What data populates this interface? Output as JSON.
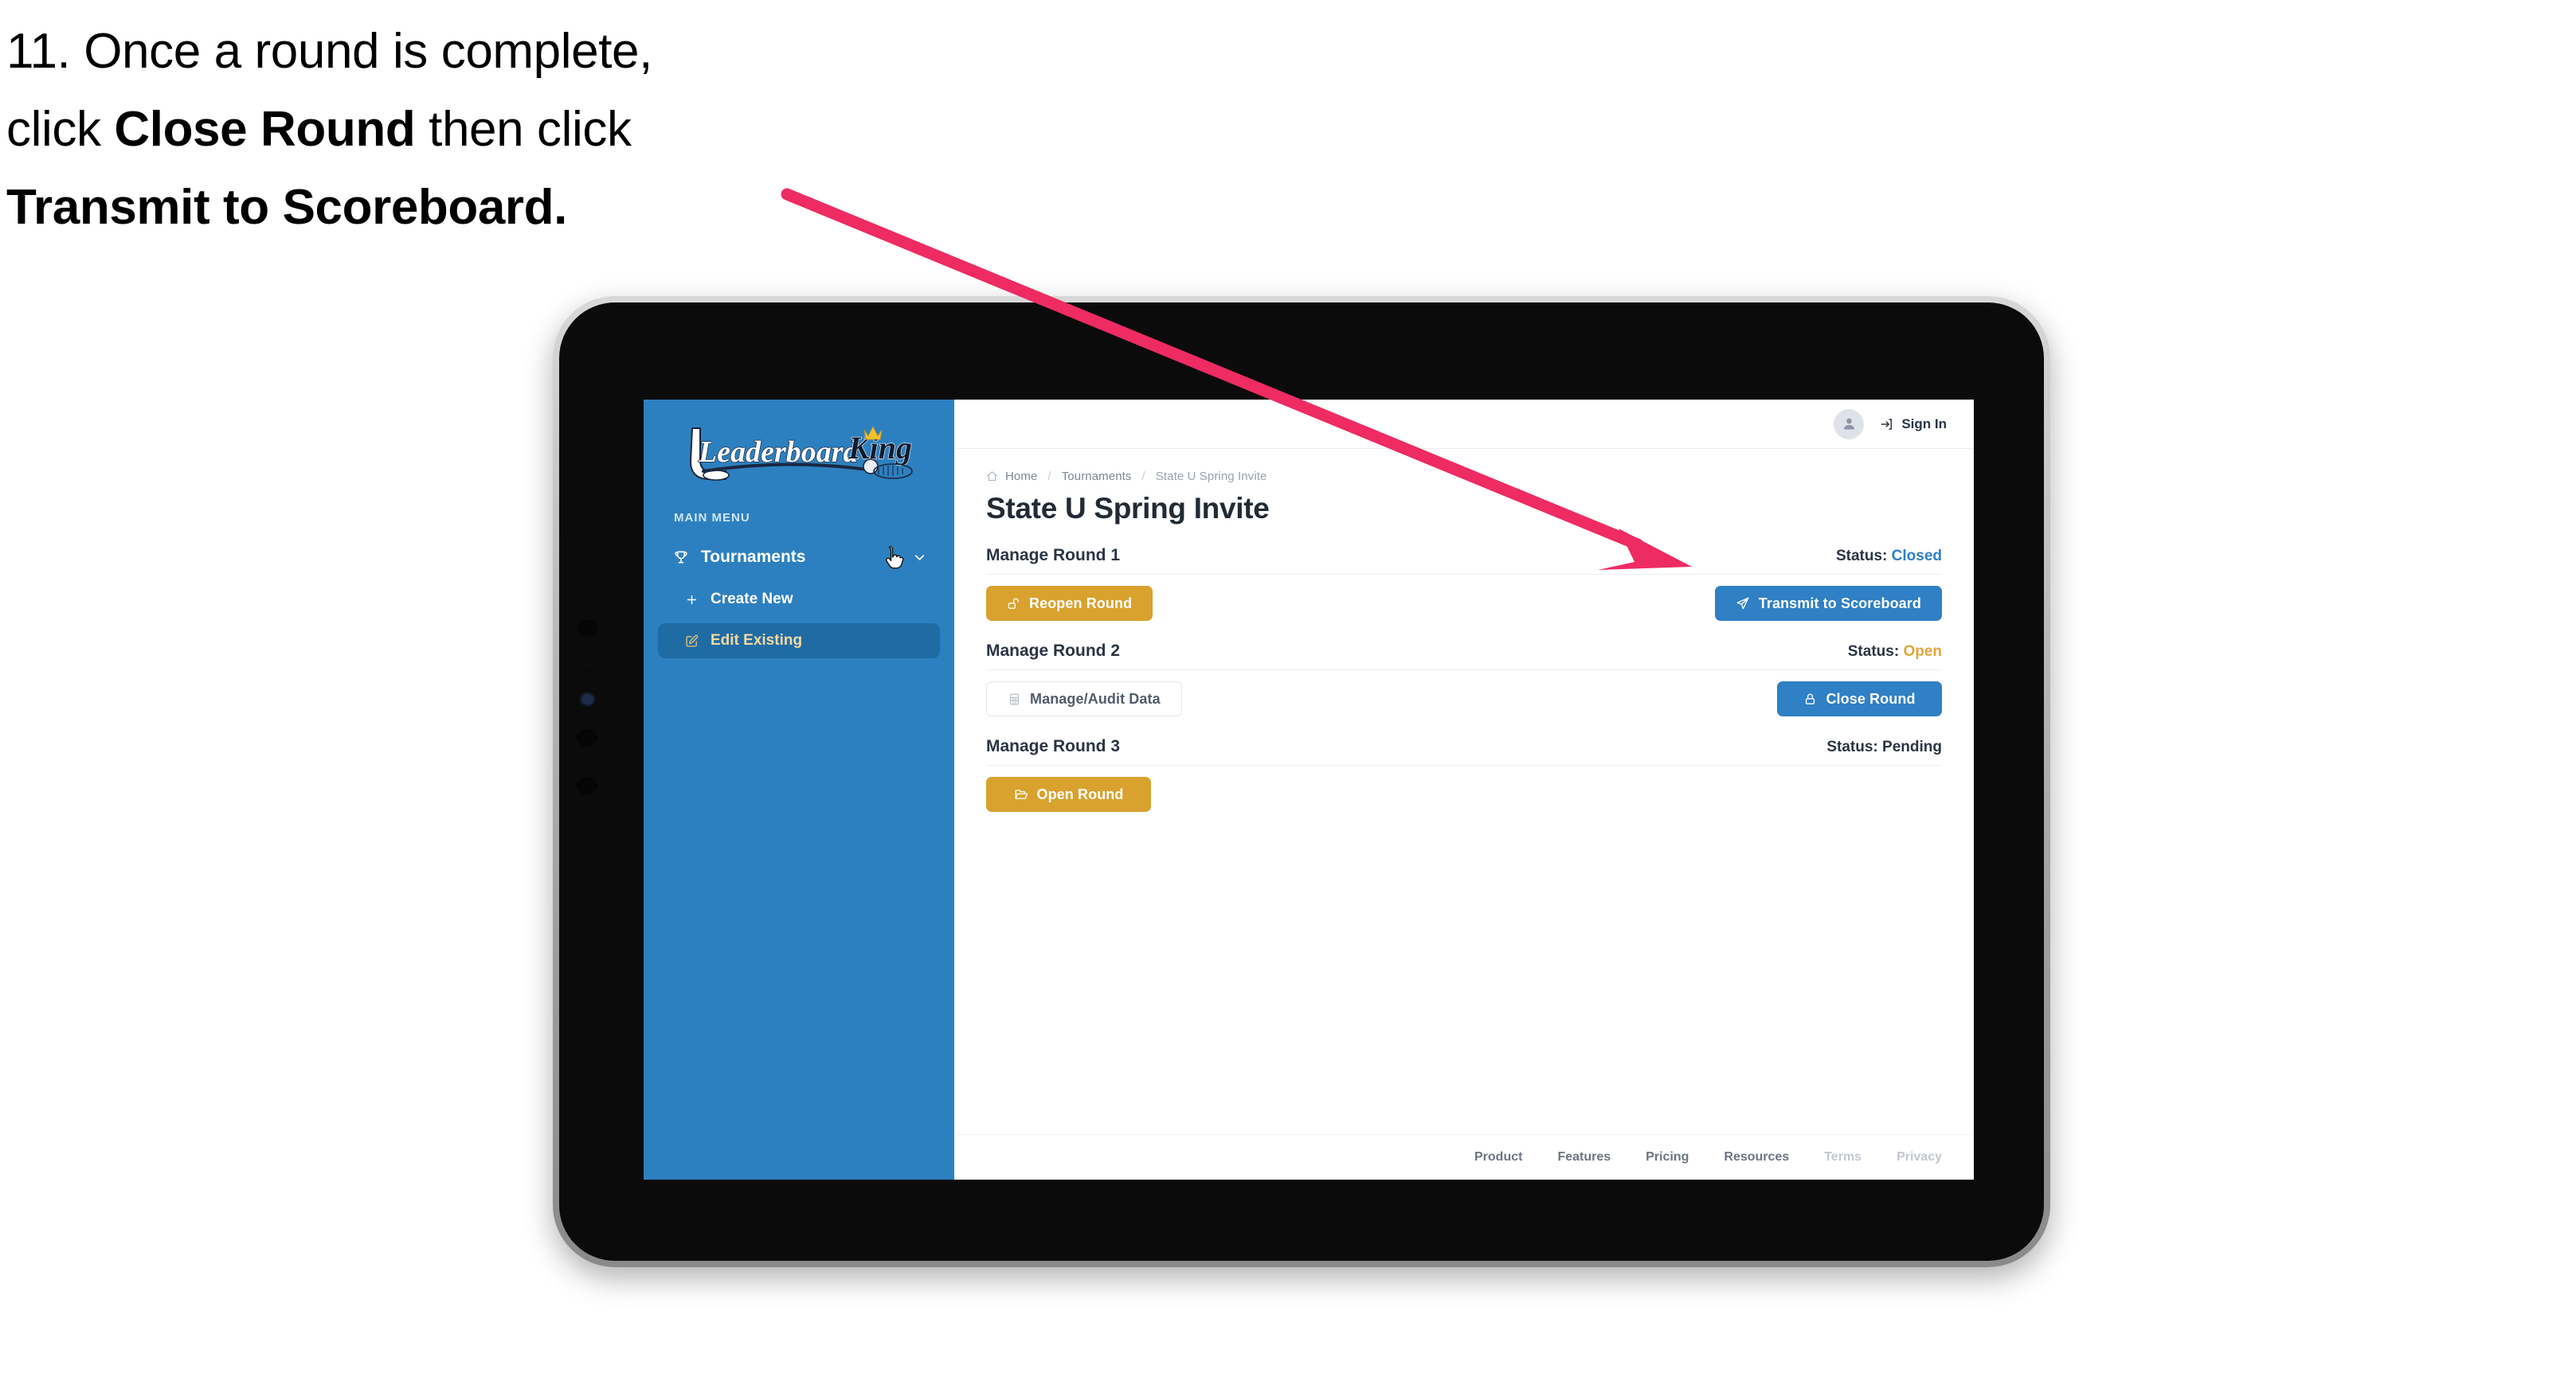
{
  "caption": {
    "number": "11.",
    "line1_pre": "Once a round is complete,",
    "line2_pre": "click ",
    "line2_bold": "Close Round",
    "line2_post": " then click",
    "line3_bold": "Transmit to Scoreboard."
  },
  "annotation": {
    "arrow_color": "#ee2b63"
  },
  "device": {
    "type": "tablet",
    "body_color": "#b5b5b5",
    "screen_color": "#0b0b0b"
  },
  "sidebar": {
    "brand": {
      "word1": "Leaderboard",
      "word2": "King"
    },
    "section_label": "MAIN MENU",
    "accent_bg": "#2d80bf",
    "items": [
      {
        "label": "Tournaments",
        "icon": "trophy-icon",
        "chevron": "chevron-down-icon",
        "active": false
      },
      {
        "label": "Create New",
        "icon": "plus-icon",
        "active": false
      },
      {
        "label": "Edit Existing",
        "icon": "edit-pencil-icon",
        "active": true
      }
    ],
    "cursor": "pointing-hand-cursor"
  },
  "topbar": {
    "avatar": "user-avatar-icon",
    "signin_label": "Sign In",
    "signin_icon": "sign-in-arrow-icon"
  },
  "breadcrumb": {
    "home_icon": "home-icon",
    "items": [
      "Home",
      "Tournaments",
      "State U Spring Invite"
    ],
    "separator": "/"
  },
  "page": {
    "title": "State U Spring Invite"
  },
  "rounds": [
    {
      "title": "Manage Round 1",
      "status_label": "Status:",
      "status_value": "Closed",
      "status_kind": "closed",
      "left_button": {
        "label": "Reopen Round",
        "icon": "unlock-icon",
        "style": "gold"
      },
      "right_button": {
        "label": "Transmit to Scoreboard",
        "icon": "paper-plane-icon",
        "style": "blue"
      }
    },
    {
      "title": "Manage Round 2",
      "status_label": "Status:",
      "status_value": "Open",
      "status_kind": "open",
      "left_button": {
        "label": "Manage/Audit Data",
        "icon": "table-grid-icon",
        "style": "ghost"
      },
      "right_button": {
        "label": "Close Round",
        "icon": "lock-icon",
        "style": "blue"
      }
    },
    {
      "title": "Manage Round 3",
      "status_label": "Status:",
      "status_value": "Pending",
      "status_kind": "pending",
      "left_button": {
        "label": "Open Round",
        "icon": "open-folder-icon",
        "style": "gold"
      },
      "right_button": null
    }
  ],
  "footer": {
    "links": [
      {
        "label": "Product",
        "muted": false
      },
      {
        "label": "Features",
        "muted": false
      },
      {
        "label": "Pricing",
        "muted": false
      },
      {
        "label": "Resources",
        "muted": false
      },
      {
        "label": "Terms",
        "muted": true
      },
      {
        "label": "Privacy",
        "muted": true
      }
    ]
  },
  "colors": {
    "brand_blue": "#2d80bf",
    "button_blue": "#2f80c4",
    "button_gold": "#d9a22e",
    "status_open": "#e0a63a",
    "status_closed": "#2f80c4",
    "arrow_pink": "#ee2b63"
  }
}
